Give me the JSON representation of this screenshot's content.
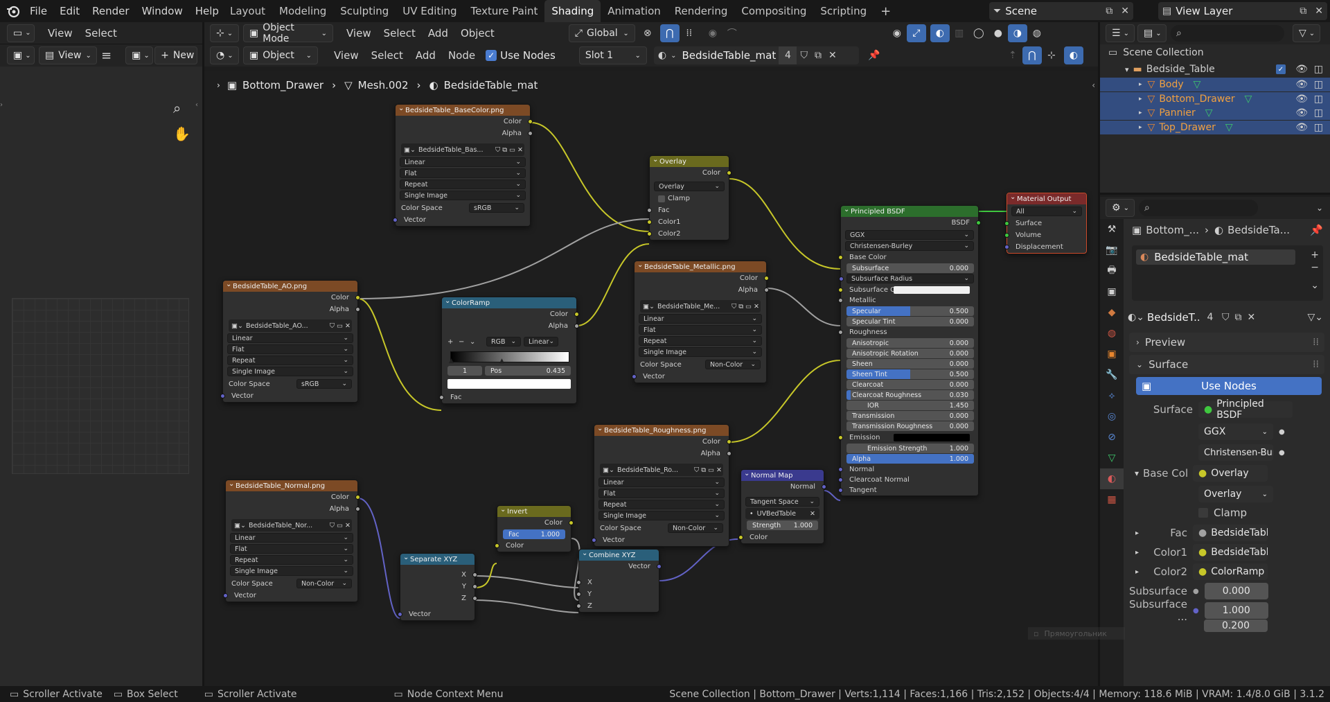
{
  "topbar": {
    "menus": [
      "File",
      "Edit",
      "Render",
      "Window",
      "Help"
    ],
    "workspaces": [
      "Layout",
      "Modeling",
      "Sculpting",
      "UV Editing",
      "Texture Paint",
      "Shading",
      "Animation",
      "Rendering",
      "Compositing",
      "Scripting"
    ],
    "scene": "Scene",
    "view_layer": "View Layer"
  },
  "left_panel": {
    "view": "View",
    "select": "Select",
    "view2": "View",
    "new": "New"
  },
  "viewport_header": {
    "mode": "Object Mode",
    "menus": [
      "View",
      "Select",
      "Add",
      "Object"
    ],
    "orientation": "Global"
  },
  "node_header": {
    "object_dd": "Object",
    "menus": [
      "View",
      "Select",
      "Add",
      "Node"
    ],
    "use_nodes": "Use Nodes",
    "slot": "Slot 1",
    "material": "BedsideTable_mat",
    "users": "4"
  },
  "breadcrumb": {
    "object": "Bottom_Drawer",
    "mesh": "Mesh.002",
    "material": "BedsideTable_mat"
  },
  "outliner": {
    "title": "Scene Collection",
    "collection": "Bedside_Table",
    "objects": [
      {
        "name": "Body"
      },
      {
        "name": "Bottom_Drawer"
      },
      {
        "name": "Pannier"
      },
      {
        "name": "Top_Drawer"
      }
    ]
  },
  "properties": {
    "bc_object": "Bottom_...",
    "bc_material": "BedsideTa...",
    "material_slot": "BedsideTable_mat",
    "mat_short": "BedsideT...",
    "users": "4",
    "preview": "Preview",
    "surface": "Surface",
    "use_nodes": "Use Nodes",
    "surface_label": "Surface",
    "surface_value": "Principled BSDF",
    "dist": "GGX",
    "sss": "Christensen-Bur...",
    "base_col_label": "Base Col",
    "base_col_value": "Overlay",
    "blend": "Overlay",
    "clamp": "Clamp",
    "fac_label": "Fac",
    "fac_value": "BedsideTable_A",
    "color1_label": "Color1",
    "color1_value": "BedsideTable_B",
    "color2_label": "Color2",
    "color2_value": "ColorRamp",
    "subsurface_label": "Subsurface",
    "subsurface_value": "0.000",
    "ssr_label": "Subsurface ...",
    "ssr_v1": "1.000",
    "ssr_v2": "0.200"
  },
  "tooltip_ghost": "Прямоугольник",
  "statusbar": {
    "left": [
      "Scroller Activate",
      "Box Select",
      "Scroller Activate",
      "Node Context Menu"
    ],
    "right": "Scene Collection | Bottom_Drawer | Verts:1,114 | Faces:1,166 | Tris:2,152 | Objects:4/4 | Memory: 118.6 MiB | VRAM: 1.4/8.0 GiB | 3.1.2"
  },
  "nodes": {
    "base": {
      "title": "BedsideTable_BaseColor.png",
      "out1": "Color",
      "out2": "Alpha",
      "img": "BedsideTable_Bas...",
      "opt": [
        "Linear",
        "Flat",
        "Repeat",
        "Single Image"
      ],
      "cs_label": "Color Space",
      "cs": "sRGB",
      "vec": "Vector"
    },
    "ao": {
      "title": "BedsideTable_AO.png",
      "out1": "Color",
      "out2": "Alpha",
      "img": "BedsideTable_AO...",
      "opt": [
        "Linear",
        "Flat",
        "Repeat",
        "Single Image"
      ],
      "cs_label": "Color Space",
      "cs": "sRGB",
      "vec": "Vector"
    },
    "normal": {
      "title": "BedsideTable_Normal.png",
      "out1": "Color",
      "out2": "Alpha",
      "img": "BedsideTable_Nor...",
      "opt": [
        "Linear",
        "Flat",
        "Repeat",
        "Single Image"
      ],
      "cs_label": "Color Space",
      "cs": "Non-Color",
      "vec": "Vector"
    },
    "metal": {
      "title": "BedsideTable_Metallic.png",
      "out1": "Color",
      "out2": "Alpha",
      "img": "BedsideTable_Me...",
      "opt": [
        "Linear",
        "Flat",
        "Repeat",
        "Single Image"
      ],
      "cs_label": "Color Space",
      "cs": "Non-Color",
      "vec": "Vector"
    },
    "rough": {
      "title": "BedsideTable_Roughness.png",
      "out1": "Color",
      "out2": "Alpha",
      "img": "BedsideTable_Ro...",
      "opt": [
        "Linear",
        "Flat",
        "Repeat",
        "Single Image"
      ],
      "cs_label": "Color Space",
      "cs": "Non-Color",
      "vec": "Vector"
    },
    "overlay": {
      "title": "Overlay",
      "out": "Color",
      "blend": "Overlay",
      "clamp": "Clamp",
      "in": [
        "Fac",
        "Color1",
        "Color2"
      ]
    },
    "ramp": {
      "title": "ColorRamp",
      "out1": "Color",
      "out2": "Alpha",
      "mode": "RGB",
      "interp": "Linear",
      "index": "1",
      "pos_label": "Pos",
      "pos": "0.435",
      "pos_value": 0.435,
      "fac": "Fac"
    },
    "invert": {
      "title": "Invert",
      "out": "Color",
      "fac_label": "Fac",
      "fac": "1.000",
      "in": "Color"
    },
    "sepxyz": {
      "title": "Separate XYZ",
      "out": [
        "X",
        "Y",
        "Z"
      ],
      "in": "Vector"
    },
    "combxyz": {
      "title": "Combine XYZ",
      "out": "Vector",
      "in": [
        "X",
        "Y",
        "Z"
      ]
    },
    "nmap": {
      "title": "Normal Map",
      "out": "Normal",
      "space": "Tangent Space",
      "uv": "UVBedTable",
      "strength_label": "Strength",
      "strength": "1.000",
      "in": "Color"
    },
    "bsdf": {
      "title": "Principled BSDF",
      "out": "BSDF",
      "dist": "GGX",
      "sss": "Christensen-Burley",
      "rows": [
        {
          "type": "in",
          "label": "Base Color",
          "sock": "col"
        },
        {
          "type": "field",
          "label": "Subsurface",
          "value": "0.000",
          "fill": 0,
          "sock": "gry"
        },
        {
          "type": "sel",
          "label": "Subsurface Radius",
          "sock": "vec"
        },
        {
          "type": "color",
          "label": "Subsurface Color",
          "swatch": "#f0f0f0",
          "sock": "col"
        },
        {
          "type": "in",
          "label": "Metallic",
          "sock": "gry"
        },
        {
          "type": "field",
          "label": "Specular",
          "value": "0.500",
          "fill": 0.5,
          "sock": "gry"
        },
        {
          "type": "field",
          "label": "Specular Tint",
          "value": "0.000",
          "fill": 0,
          "sock": "gry"
        },
        {
          "type": "in",
          "label": "Roughness",
          "sock": "gry"
        },
        {
          "type": "field",
          "label": "Anisotropic",
          "value": "0.000",
          "fill": 0,
          "sock": "gry"
        },
        {
          "type": "field",
          "label": "Anisotropic Rotation",
          "value": "0.000",
          "fill": 0,
          "sock": "gry"
        },
        {
          "type": "field",
          "label": "Sheen",
          "value": "0.000",
          "fill": 0,
          "sock": "gry"
        },
        {
          "type": "field",
          "label": "Sheen Tint",
          "value": "0.500",
          "fill": 0.5,
          "sock": "gry"
        },
        {
          "type": "field",
          "label": "Clearcoat",
          "value": "0.000",
          "fill": 0,
          "sock": "gry"
        },
        {
          "type": "field",
          "label": "Clearcoat Roughness",
          "value": "0.030",
          "fill": 0.03,
          "sock": "gry"
        },
        {
          "type": "field",
          "label": "IOR",
          "value": "1.450",
          "fill": 0,
          "sock": "gry",
          "center": true
        },
        {
          "type": "field",
          "label": "Transmission",
          "value": "0.000",
          "fill": 0,
          "sock": "gry"
        },
        {
          "type": "field",
          "label": "Transmission Roughness",
          "value": "0.000",
          "fill": 0,
          "sock": "gry"
        },
        {
          "type": "color",
          "label": "Emission",
          "swatch": "#000000",
          "sock": "col"
        },
        {
          "type": "field",
          "label": "Emission Strength",
          "value": "1.000",
          "fill": 0,
          "sock": "gry",
          "center": true
        },
        {
          "type": "field",
          "label": "Alpha",
          "value": "1.000",
          "fill": 1,
          "sock": "gry"
        },
        {
          "type": "in",
          "label": "Normal",
          "sock": "vec"
        },
        {
          "type": "in",
          "label": "Clearcoat Normal",
          "sock": "vec"
        },
        {
          "type": "in",
          "label": "Tangent",
          "sock": "vec"
        }
      ]
    },
    "output": {
      "title": "Material Output",
      "target": "All",
      "in": [
        "Surface",
        "Volume",
        "Displacement"
      ]
    }
  }
}
